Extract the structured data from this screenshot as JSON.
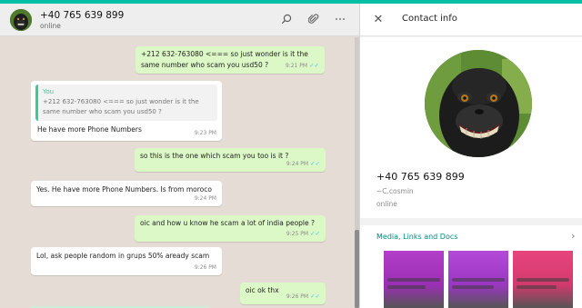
{
  "chat_header": {
    "contact_name": "+40 765 639 899",
    "status": "online",
    "icons": [
      "search-icon",
      "attach-icon",
      "menu-icon"
    ]
  },
  "messages": [
    {
      "direction": "out",
      "lines": [
        "+212 632-763080   <=== so just wonder is it the",
        "same number who scam you usd50 ?"
      ],
      "time": "9:21 PM",
      "ticks": "✓✓"
    },
    {
      "direction": "in",
      "quote": {
        "author": "You",
        "lines": [
          "+212 632-763080   <=== so just wonder is it the",
          "same number who scam you usd50 ?"
        ]
      },
      "lines": [
        "He have more Phone Numbers"
      ],
      "time": "9:23 PM"
    },
    {
      "direction": "out",
      "lines": [
        "so this is the one which scam you too is it ?"
      ],
      "time": "9:24 PM",
      "ticks": "✓✓"
    },
    {
      "direction": "in",
      "lines": [
        "Yes. He have more Phone Numbers. Is from moroco"
      ],
      "time": "9:24 PM"
    },
    {
      "direction": "out",
      "lines": [
        "oic and how u know he scam a lot of india people ?"
      ],
      "time": "9:25 PM",
      "ticks": "✓✓"
    },
    {
      "direction": "in",
      "lines": [
        "Lol, ask people random in grups  50% aready scam"
      ],
      "time": "9:26 PM"
    },
    {
      "direction": "out",
      "lines": [
        "oic ok thx"
      ],
      "time": "9:26 PM",
      "ticks": "✓✓"
    }
  ],
  "info_panel": {
    "title": "Contact info",
    "phone": "+40 765 639 899",
    "nickname": "~C.cosmin",
    "status": "online",
    "media_title": "Media, Links and Docs",
    "media_arrow": "›",
    "close_glyph": "✕"
  },
  "colors": {
    "accent": "#00bfa5",
    "outgoing_bubble": "#dcf8c6",
    "incoming_bubble": "#ffffff",
    "chat_background": "#e5ddd5",
    "media_link": "#00897b",
    "quote_author": "#35cd96"
  }
}
